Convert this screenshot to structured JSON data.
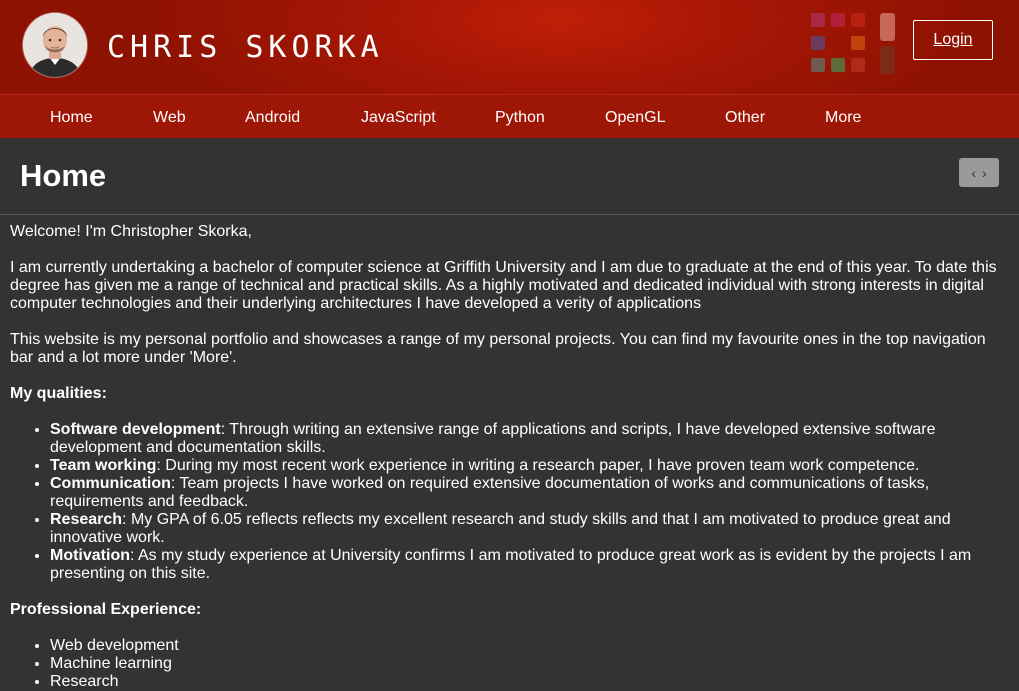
{
  "header": {
    "site_title": "CHRIS SKORKA",
    "login_label": "Login",
    "accent": "#a51605"
  },
  "nav": {
    "items": [
      "Home",
      "Web",
      "Android",
      "JavaScript",
      "Python",
      "OpenGL",
      "Other",
      "More"
    ]
  },
  "page": {
    "title": "Home",
    "pager_prev": "‹",
    "pager_next": "›"
  },
  "content": {
    "welcome": "Welcome! I'm Christopher Skorka,",
    "intro": "I am currently undertaking a bachelor of computer science at Griffith University and I am due to graduate at the end of this year. To date this degree has given me a range of technical and practical skills. As a highly motivated and dedicated individual with strong interests in digital computer technologies and their underlying architectures I have developed a verity of applications",
    "portfolio": "This website is my personal portfolio and showcases a range of my personal projects. You can find my favourite ones in the top navigation bar and a lot more under 'More'.",
    "qualities_heading": "My qualities:",
    "qualities": [
      {
        "term": "Software development",
        "text": ": Through writing an extensive range of applications and scripts, I have developed extensive software development and documentation skills."
      },
      {
        "term": "Team working",
        "text": ": During my most recent work experience in writing a research paper, I have proven team work competence."
      },
      {
        "term": "Communication",
        "text": ": Team projects I have worked on required extensive documentation of works and communications of tasks, requirements and feedback."
      },
      {
        "term": "Research",
        "text": ": My GPA of 6.05 reflects reflects my excellent research and study skills and that I am motivated to produce great and innovative work."
      },
      {
        "term": "Motivation",
        "text": ": As my study experience at University confirms I am motivated to produce great work as is evident by the projects I am presenting on this site."
      }
    ],
    "experience_heading": "Professional Experience:",
    "experience": [
      "Web development",
      "Machine learning",
      "Research"
    ]
  }
}
